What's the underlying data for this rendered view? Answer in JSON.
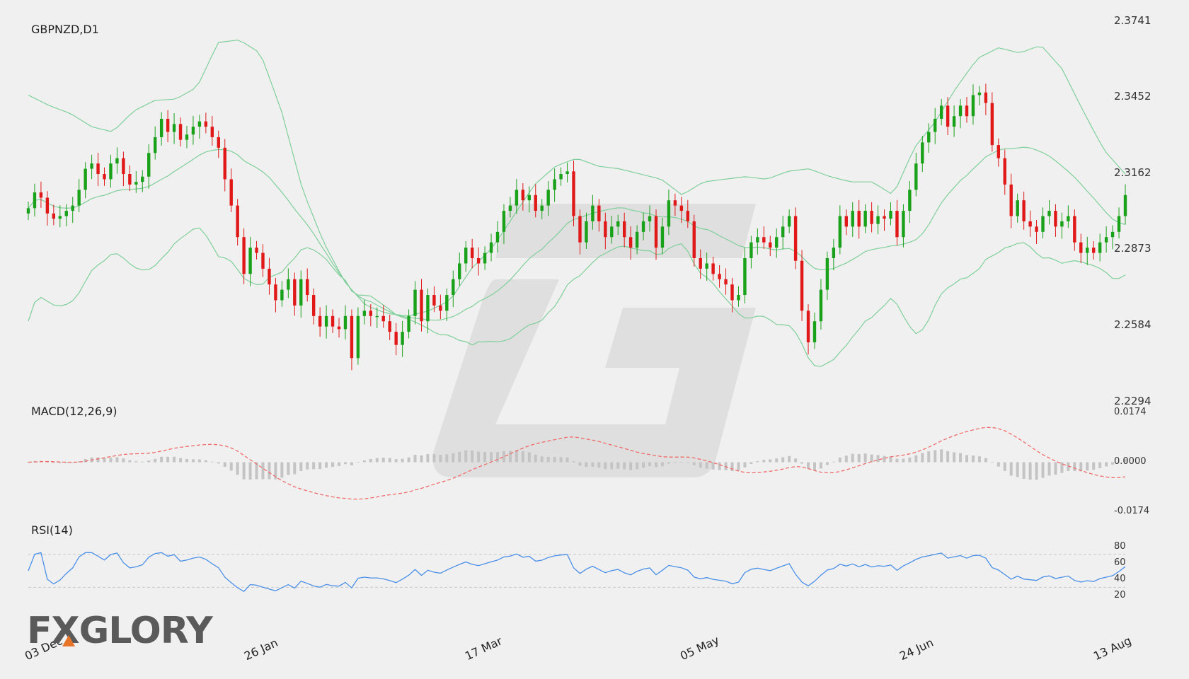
{
  "chart_data": {
    "type": "candlestick",
    "symbol_label": "GBPNZD,D1",
    "x_tick_labels": [
      "03 Dec",
      "26 Jan",
      "17 Mar",
      "05 May",
      "24 Jun",
      "13 Aug"
    ],
    "price_axis": {
      "ticks": [
        "2.3741",
        "2.3452",
        "2.3162",
        "2.2873",
        "2.2584",
        "2.2294"
      ],
      "ylim": [
        2.2294,
        2.3741
      ]
    },
    "close_series_approx": [
      2.303,
      2.309,
      2.307,
      2.301,
      2.299,
      2.3,
      2.302,
      2.304,
      2.31,
      2.318,
      2.32,
      2.316,
      2.314,
      2.32,
      2.322,
      2.316,
      2.312,
      2.313,
      2.315,
      2.324,
      2.33,
      2.337,
      2.332,
      2.335,
      2.329,
      2.331,
      2.334,
      2.336,
      2.334,
      2.33,
      2.326,
      2.314,
      2.304,
      2.292,
      2.278,
      2.288,
      2.286,
      2.28,
      2.274,
      2.268,
      2.272,
      2.276,
      2.266,
      2.276,
      2.27,
      2.262,
      2.258,
      2.262,
      2.258,
      2.257,
      2.262,
      2.246,
      2.262,
      2.264,
      2.262,
      2.262,
      2.26,
      2.256,
      2.251,
      2.256,
      2.262,
      2.272,
      2.26,
      2.27,
      2.266,
      2.264,
      2.27,
      2.276,
      2.282,
      2.288,
      2.284,
      2.282,
      2.286,
      2.29,
      2.294,
      2.302,
      2.304,
      2.31,
      2.306,
      2.308,
      2.302,
      2.304,
      2.31,
      2.314,
      2.316,
      2.317,
      2.3,
      2.29,
      2.298,
      2.304,
      2.298,
      2.292,
      2.296,
      2.298,
      2.292,
      2.288,
      2.294,
      2.298,
      2.3,
      2.288,
      2.296,
      2.306,
      2.304,
      2.302,
      2.298,
      2.284,
      2.28,
      2.282,
      2.278,
      2.276,
      2.274,
      2.268,
      2.27,
      2.284,
      2.29,
      2.292,
      2.29,
      2.288,
      2.292,
      2.296,
      2.3,
      2.283,
      2.264,
      2.252,
      2.26,
      2.272,
      2.284,
      2.288,
      2.3,
      2.296,
      2.302,
      2.296,
      2.302,
      2.297,
      2.3,
      2.299,
      2.302,
      2.292,
      2.302,
      2.31,
      2.32,
      2.328,
      2.332,
      2.337,
      2.342,
      2.334,
      2.338,
      2.342,
      2.338,
      2.346,
      2.347,
      2.343,
      2.327,
      2.322,
      2.312,
      2.3,
      2.306,
      2.298,
      2.296,
      2.294,
      2.3,
      2.302,
      2.296,
      2.298,
      2.3,
      2.29,
      2.286,
      2.288,
      2.286,
      2.29,
      2.292,
      2.294,
      2.3,
      2.308
    ],
    "bollinger": {
      "label": "",
      "upper_approx": [
        2.346,
        2.342,
        2.339,
        2.334,
        2.332,
        2.34,
        2.344,
        2.3445,
        2.349,
        2.366,
        2.367,
        2.362,
        2.34,
        2.31,
        2.29,
        2.275,
        2.266,
        2.263,
        2.262,
        2.264,
        2.268,
        2.28,
        2.288,
        2.3,
        2.312,
        2.319,
        2.322,
        2.319,
        2.318,
        2.316,
        2.314,
        2.308,
        2.313,
        2.314,
        2.315,
        2.314,
        2.317,
        2.318,
        2.315,
        2.313,
        2.313,
        2.308,
        2.326,
        2.336,
        2.349,
        2.36,
        2.364,
        2.362,
        2.365,
        2.356,
        2.34,
        2.325,
        2.316
      ]
    },
    "macd": {
      "label": "MACD(12,26,9)",
      "ticks": [
        "0.0174",
        "0.0000",
        "-0.0174"
      ],
      "ylim": [
        -0.0174,
        0.0174
      ]
    },
    "rsi": {
      "label": "RSI(14)",
      "ticks": [
        "80",
        "60",
        "40",
        "20"
      ],
      "levels": [
        70,
        30
      ],
      "ylim": [
        20,
        80
      ]
    },
    "colors": {
      "up": "#1aa11a",
      "down": "#e01818",
      "bands": "#7fcf9a",
      "macd_signal": "#f06a6a",
      "macd_hist": "#c4c4c4",
      "rsi_line": "#4a90e8",
      "grid": "#c8c8c8"
    }
  },
  "watermark_text": "FXGLORY"
}
